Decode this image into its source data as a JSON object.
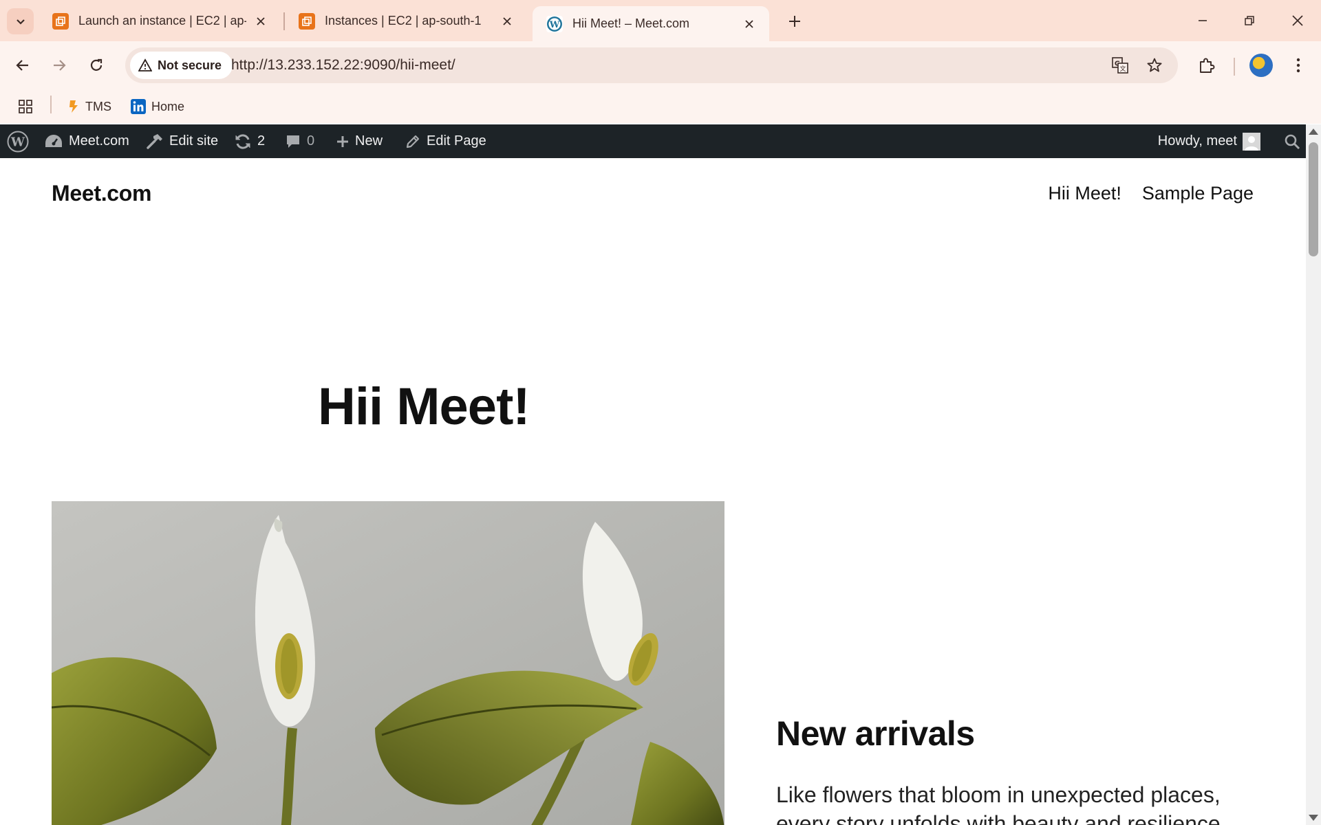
{
  "browser": {
    "tabs": [
      {
        "title": "Launch an instance | EC2 | ap-south-1",
        "favicon": "aws-console-icon",
        "active": false
      },
      {
        "title": "Instances | EC2 | ap-south-1",
        "favicon": "aws-console-icon",
        "active": false
      },
      {
        "title": "Hii Meet! – Meet.com",
        "favicon": "wordpress-icon",
        "active": true
      }
    ],
    "security_label": "Not secure",
    "url": "http://13.233.152.22:9090/hii-meet/",
    "bookmarks": [
      {
        "label": "TMS",
        "icon": "tms-icon"
      },
      {
        "label": "Home",
        "icon": "linkedin-icon"
      }
    ],
    "colors": {
      "tabbar": "#fbe1d6",
      "toolbar": "#fdf3ef",
      "aws": "#e8731a",
      "linkedin": "#0a66c2"
    }
  },
  "admin_bar": {
    "site_name": "Meet.com",
    "edit_site": "Edit site",
    "updates_count": "2",
    "comments_count": "0",
    "new_label": "New",
    "edit_page": "Edit Page",
    "howdy": "Howdy, meet",
    "background": "#1d2327"
  },
  "site": {
    "title": "Meet.com",
    "nav": [
      "Hii Meet!",
      "Sample Page"
    ]
  },
  "page": {
    "heading": "Hii Meet!",
    "section_title": "New arrivals",
    "section_text": "Like flowers that bloom in unexpected places, every story unfolds with beauty and resilience"
  }
}
